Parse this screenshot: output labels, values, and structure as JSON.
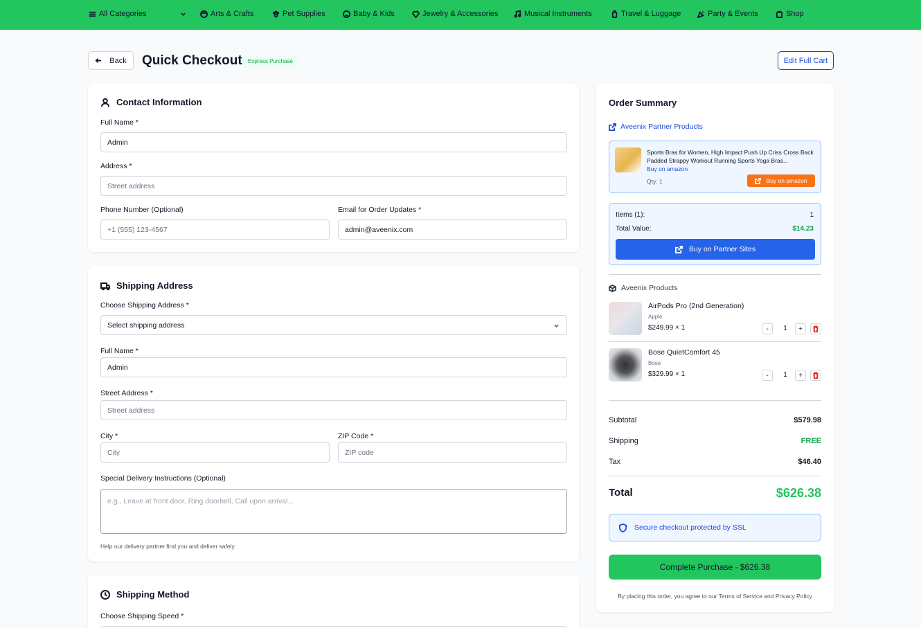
{
  "nav": {
    "all_categories": "All Categories",
    "items": [
      "Arts & Crafts",
      "Pet Supplies",
      "Baby & Kids",
      "Jewelry & Accessories",
      "Musical Instruments",
      "Travel & Luggage",
      "Party & Events",
      "Shop"
    ]
  },
  "header": {
    "back": "Back",
    "title": "Quick Checkout",
    "badge": "Express Purchase",
    "edit_cart": "Edit Full Cart"
  },
  "contact": {
    "title": "Contact Information",
    "full_name_label": "Full Name *",
    "full_name_value": "Admin",
    "address_label": "Address *",
    "address_placeholder": "Street address",
    "phone_label": "Phone Number (Optional)",
    "phone_placeholder": "+1 (555) 123-4567",
    "email_label": "Email for Order Updates *",
    "email_value": "admin@aveenix.com"
  },
  "shipping": {
    "title": "Shipping Address",
    "choose_label": "Choose Shipping Address *",
    "choose_value": "Select shipping address",
    "full_name_label": "Full Name *",
    "full_name_value": "Admin",
    "street_label": "Street Address *",
    "street_placeholder": "Street address",
    "city_label": "City *",
    "city_placeholder": "City",
    "zip_label": "ZIP Code *",
    "zip_placeholder": "ZIP code",
    "instructions_label": "Special Delivery Instructions (Optional)",
    "instructions_placeholder": "e.g., Leave at front door, Ring doorbell, Call upon arrival...",
    "help": "Help our delivery partner find you and deliver safely"
  },
  "method": {
    "title": "Shipping Method",
    "speed_label": "Choose Shipping Speed *"
  },
  "summary": {
    "title": "Order Summary",
    "partner_link": "Aveenix Partner Products",
    "partner_product": {
      "title": "Sports Bras for Women, High Impact Push Up Criss Cross Back Padded Strappy Workout Running Sports Yoga Bras...",
      "link": "Buy on amazon",
      "qty": "Qty: 1",
      "buy": "Buy on amazon"
    },
    "items_label": "Items (1):",
    "items_value": "1",
    "total_value_label": "Total Value:",
    "total_value": "$14.23",
    "buy_partner": "Buy on Partner Sites",
    "aveenix_title": "Aveenix Products",
    "products": [
      {
        "name": "AirPods Pro (2nd Generation)",
        "brand": "Apple",
        "price": "$249.99 × 1",
        "qty": "1",
        "minus": "-",
        "plus": "+"
      },
      {
        "name": "Bose QuietComfort 45",
        "brand": "Bose",
        "price": "$329.99 × 1",
        "qty": "1",
        "minus": "-",
        "plus": "+"
      }
    ],
    "subtotal_label": "Subtotal",
    "subtotal": "$579.98",
    "shipping_label": "Shipping",
    "shipping": "FREE",
    "tax_label": "Tax",
    "tax": "$46.40",
    "total_label": "Total",
    "total": "$626.38",
    "ssl": "Secure checkout protected by SSL",
    "complete": "Complete Purchase - $626.38",
    "terms": "By placing this order, you agree to our Terms of Service and Privacy Policy"
  },
  "colors": {
    "brand_green": "#22c55e",
    "link_blue": "#1d4ed8",
    "partner_orange": "#f97316"
  }
}
